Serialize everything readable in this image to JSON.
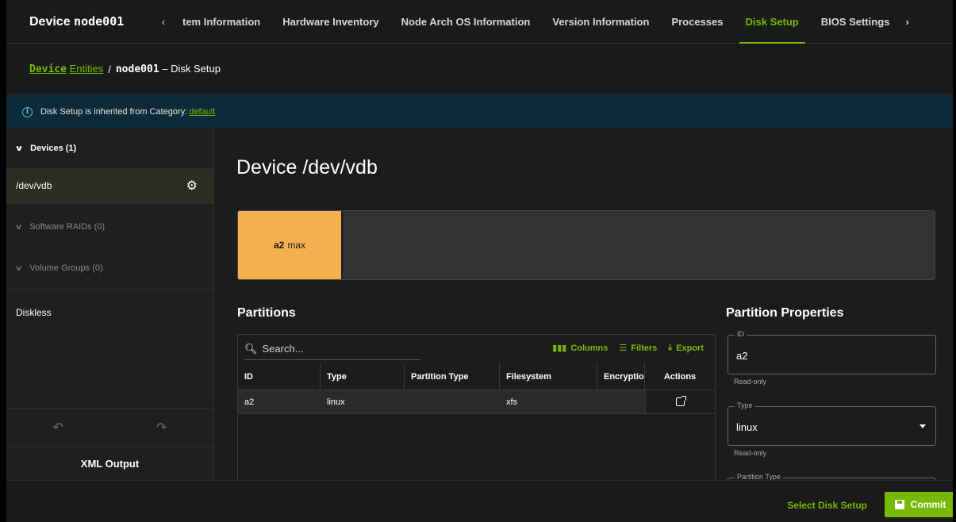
{
  "header": {
    "device_prefix": "Device ",
    "device_name": "node001",
    "tab_scroll_left": "‹",
    "tab_scroll_right": "›",
    "tabs": [
      {
        "label": "tem Information",
        "active": false
      },
      {
        "label": "Hardware Inventory",
        "active": false
      },
      {
        "label": "Node Arch OS Information",
        "active": false
      },
      {
        "label": "Version Information",
        "active": false
      },
      {
        "label": "Processes",
        "active": false
      },
      {
        "label": "Disk Setup",
        "active": true
      },
      {
        "label": "BIOS Settings",
        "active": false
      }
    ]
  },
  "breadcrumb": {
    "link_bold": "Device",
    "link_rest": "Entities",
    "separator": "/",
    "current_node": "node001",
    "current_rest": " – Disk Setup"
  },
  "banner": {
    "icon": "info-icon",
    "text": "Disk Setup is inherited from Category:",
    "link": "default"
  },
  "sidebar": {
    "devices_header": "Devices (1)",
    "selected_device": "/dev/vdb",
    "software_raids": "Software RAIDs (0)",
    "volume_groups": "Volume Groups (0)",
    "diskless": "Diskless",
    "undo_icon": "undo-icon",
    "redo_icon": "redo-icon",
    "xml_output": "XML Output"
  },
  "main": {
    "title": "Device /dev/vdb",
    "disk_bar": {
      "partition_name": "a2",
      "partition_size": "max"
    },
    "partitions_heading": "Partitions",
    "search_placeholder": "Search...",
    "toolbar": {
      "columns": "Columns",
      "filters": "Filters",
      "export": "Export"
    },
    "table": {
      "columns": [
        "ID",
        "Type",
        "Partition Type",
        "Filesystem",
        "Encryption",
        "Actions"
      ],
      "rows": [
        {
          "id": "a2",
          "type": "linux",
          "partition_type": "",
          "filesystem": "xfs",
          "encryption": ""
        }
      ]
    },
    "properties_heading": "Partition Properties",
    "properties": {
      "id_label": "ID",
      "id_value": "a2",
      "id_helper": "Read-only",
      "type_label": "Type",
      "type_value": "linux",
      "type_helper": "Read-only",
      "ptype_label": "Partition Type"
    }
  },
  "footer": {
    "select_disk_setup": "Select Disk Setup",
    "commit": "Commit"
  },
  "colors": {
    "accent": "#76b900",
    "partition": "#f5b04f",
    "banner_bg": "#0d2a3a"
  }
}
